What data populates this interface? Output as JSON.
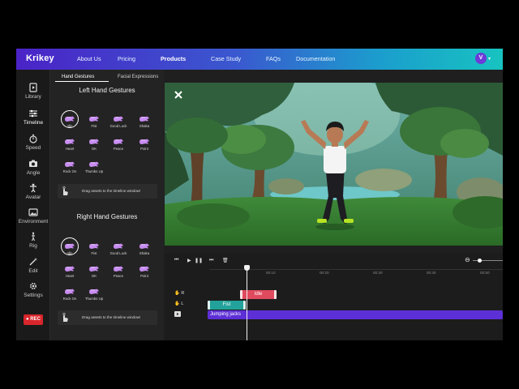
{
  "nav": {
    "logo": "Krikey",
    "links": [
      "About Us",
      "Pricing",
      "Products",
      "Case Study",
      "FAQs",
      "Documentation"
    ],
    "avatar_initial": "V"
  },
  "sidebar": {
    "items": [
      "Library",
      "Timeline",
      "Speed",
      "Angle",
      "Avatar",
      "Environment",
      "Rig",
      "Edit",
      "Settings"
    ],
    "rec_label": "● REC"
  },
  "panel": {
    "tabs": [
      "Hand Gestures",
      "Facial Expressions"
    ],
    "left_title": "Left Hand Gestures",
    "right_title": "Right Hand Gestures",
    "gestures": [
      "Idle",
      "Fist",
      "Good Luck",
      "Shaka",
      "Heart",
      "OK",
      "Peace",
      "Point",
      "Rock On",
      "Thumbs Up"
    ],
    "hint": "Drag assets to the timeline window!"
  },
  "timeline": {
    "ticks": [
      "00:10",
      "00:20",
      "00:30",
      "00:40",
      "00:50"
    ],
    "track_labels": [
      "R",
      "L"
    ],
    "clips": {
      "idle": "Idle",
      "fist": "Fist",
      "jumping": "Jumping jacks"
    }
  },
  "colors": {
    "accent": "#5d2fd6",
    "rec": "#d8262c",
    "idle_clip": "#e04a5e",
    "fist_clip": "#22a29a"
  }
}
